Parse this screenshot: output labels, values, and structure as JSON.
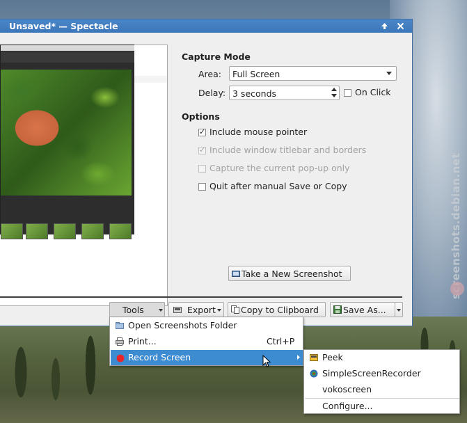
{
  "window": {
    "title": "Unsaved* — Spectacle",
    "titlebar_buttons": [
      "up-arrow-icon",
      "close-icon"
    ]
  },
  "capture_mode": {
    "heading": "Capture Mode",
    "area_label": "Area:",
    "area_value": "Full Screen",
    "delay_label": "Delay:",
    "delay_value": "3 seconds",
    "on_click_label": "On Click",
    "on_click_checked": false
  },
  "options": {
    "heading": "Options",
    "items": [
      {
        "label": "Include mouse pointer",
        "checked": true,
        "enabled": true
      },
      {
        "label": "Include window titlebar and borders",
        "checked": true,
        "enabled": false
      },
      {
        "label": "Capture the current pop-up only",
        "checked": false,
        "enabled": false
      },
      {
        "label": "Quit after manual Save or Copy",
        "checked": false,
        "enabled": true
      }
    ]
  },
  "take_screenshot_label": "Take a New Screenshot",
  "bottom_bar": {
    "tools": "Tools",
    "export": "Export",
    "copy": "Copy to Clipboard",
    "save_as": "Save As..."
  },
  "tools_menu": {
    "items": [
      {
        "label": "Open Screenshots Folder",
        "shortcut": ""
      },
      {
        "label": "Print...",
        "shortcut": "Ctrl+P"
      },
      {
        "label": "Record Screen",
        "shortcut": ""
      }
    ]
  },
  "record_menu": {
    "items": [
      {
        "label": "Peek"
      },
      {
        "label": "SimpleScreenRecorder"
      },
      {
        "label": "vokoscreen"
      },
      {
        "label": "Configure..."
      }
    ]
  },
  "watermark": "screenshots.debian.net",
  "colors": {
    "titlebar": "#3c76b8",
    "highlight": "#3d8bd1"
  }
}
